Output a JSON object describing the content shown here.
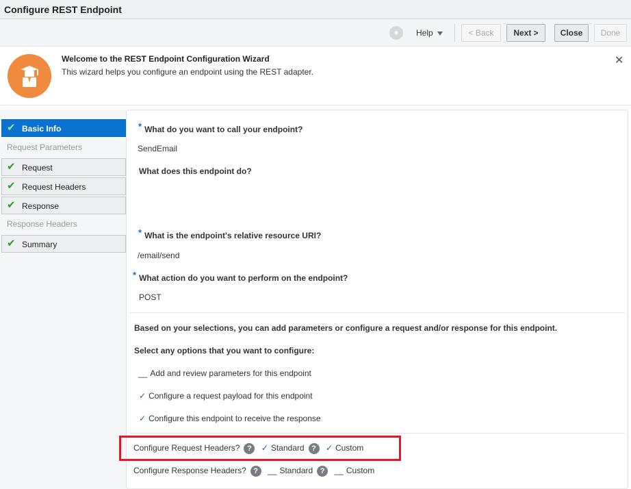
{
  "window": {
    "title": "Configure REST Endpoint"
  },
  "toolbar": {
    "help_label": "Help",
    "back_label": "< Back",
    "next_label": "Next >",
    "close_label": "Close",
    "done_label": "Done"
  },
  "welcome": {
    "title": "Welcome to the REST Endpoint Configuration Wizard",
    "subtitle": "This wizard helps you configure an endpoint using the REST adapter.",
    "close_glyph": "✕"
  },
  "sidebar": {
    "steps": [
      {
        "label": "Basic Info",
        "state": "active"
      },
      {
        "label": "Request Parameters",
        "state": "disabled"
      },
      {
        "label": "Request",
        "state": "done"
      },
      {
        "label": "Request Headers",
        "state": "done"
      },
      {
        "label": "Response",
        "state": "done"
      },
      {
        "label": "Response Headers",
        "state": "disabled"
      },
      {
        "label": "Summary",
        "state": "done"
      }
    ]
  },
  "form": {
    "q_name": "What do you want to call your endpoint?",
    "v_name": "SendEmail",
    "q_desc": "What does this endpoint do?",
    "q_uri": "What is the endpoint's relative resource URI?",
    "v_uri": "/email/send",
    "q_action": "What action do you want to perform on the endpoint?",
    "v_action": "POST",
    "info_text": "Based on your selections, you can add parameters or configure a request and/or response for this endpoint.",
    "select_text": "Select any options that you want to configure:",
    "options": [
      {
        "label": "Add and review parameters for this endpoint",
        "checked": false
      },
      {
        "label": "Configure a request payload for this endpoint",
        "checked": true
      },
      {
        "label": "Configure this endpoint to receive the response",
        "checked": true
      }
    ],
    "req_headers": {
      "label": "Configure Request Headers?",
      "standard": "Standard",
      "custom": "Custom",
      "standard_checked": true,
      "custom_checked": true
    },
    "resp_headers": {
      "label": "Configure Response Headers?",
      "standard": "Standard",
      "custom": "Custom",
      "standard_checked": false,
      "custom_checked": false
    }
  },
  "colors": {
    "active_step": "#0b73cf",
    "highlight": "#e01a2a",
    "avatar": "#ef8a3e"
  }
}
